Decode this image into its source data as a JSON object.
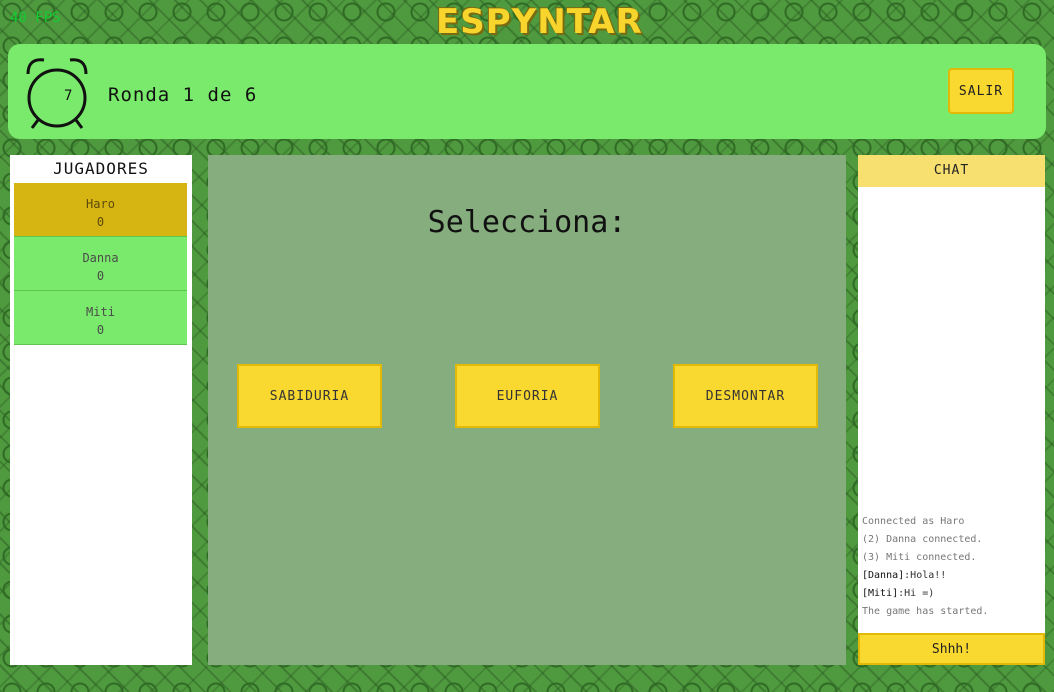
{
  "fps": "40 FPS",
  "logo": "ESPYNTAR",
  "header": {
    "timer": "7",
    "round_label": "Ronda 1 de 6",
    "exit_label": "SALIR"
  },
  "players": {
    "title": "JUGADORES",
    "items": [
      {
        "name": "Haro",
        "score": "0"
      },
      {
        "name": "Danna",
        "score": "0"
      },
      {
        "name": "Miti",
        "score": "0"
      }
    ]
  },
  "main": {
    "title": "Selecciona:",
    "options": [
      "SABIDURIA",
      "EUFORIA",
      "DESMONTAR"
    ]
  },
  "chat": {
    "title": "CHAT",
    "messages": [
      {
        "text": "Connected as Haro"
      },
      {
        "text": "(2) Danna connected."
      },
      {
        "text": "(3) Miti connected."
      },
      {
        "name": "[Danna]",
        "text": ":Hola!!"
      },
      {
        "name": "[Miti]",
        "text": ":Hi =)"
      },
      {
        "text": "The game has started."
      }
    ],
    "button_label": "Shhh!"
  },
  "colors": {
    "accent_yellow": "#f9d830",
    "panel_green": "#79ea6b",
    "active_player": "#d6b513",
    "stage_green": "#86ad7d"
  }
}
